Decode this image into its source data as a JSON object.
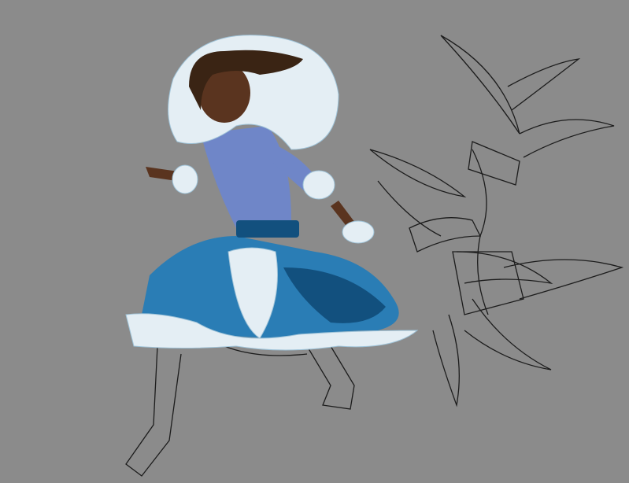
{
  "artwork": {
    "background_color": "#8b8b8b",
    "coat_color": "#2a7db5",
    "coat_dark_color": "#12507e",
    "fur_color": "#e4eef4",
    "fur_shadow_color": "#9fc3d8",
    "top_color": "#6f86c8",
    "skin_color": "#5a341f",
    "hair_color": "#3a2414",
    "lineart_color": "#1c1c1c"
  }
}
